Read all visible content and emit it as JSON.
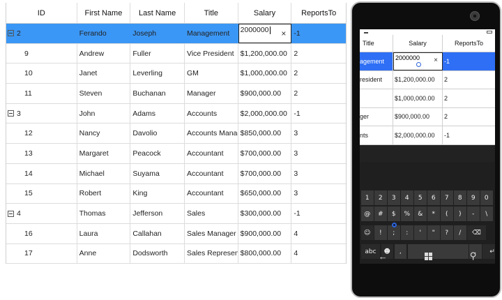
{
  "grid": {
    "columns": [
      "ID",
      "First Name",
      "Last Name",
      "Title",
      "Salary",
      "ReportsTo"
    ],
    "rows": [
      {
        "id": "2",
        "first": "Ferando",
        "last": "Joseph",
        "title": "Management",
        "salary": "2000000",
        "reports": "-1"
      },
      {
        "id": "9",
        "first": "Andrew",
        "last": "Fuller",
        "title": "Vice President",
        "salary": "$1,200,000.00",
        "reports": "2"
      },
      {
        "id": "10",
        "first": "Janet",
        "last": "Leverling",
        "title": "GM",
        "salary": "$1,000,000.00",
        "reports": "2"
      },
      {
        "id": "11",
        "first": "Steven",
        "last": "Buchanan",
        "title": "Manager",
        "salary": "$900,000.00",
        "reports": "2"
      },
      {
        "id": "3",
        "first": "John",
        "last": "Adams",
        "title": "Accounts",
        "salary": "$2,000,000.00",
        "reports": "-1"
      },
      {
        "id": "12",
        "first": "Nancy",
        "last": "Davolio",
        "title": "Accounts Manager",
        "salary": "$850,000.00",
        "reports": "3"
      },
      {
        "id": "13",
        "first": "Margaret",
        "last": "Peacock",
        "title": "Accountant",
        "salary": "$700,000.00",
        "reports": "3"
      },
      {
        "id": "14",
        "first": "Michael",
        "last": "Suyama",
        "title": "Accountant",
        "salary": "$700,000.00",
        "reports": "3"
      },
      {
        "id": "15",
        "first": "Robert",
        "last": "King",
        "title": "Accountant",
        "salary": "$650,000.00",
        "reports": "3"
      },
      {
        "id": "4",
        "first": "Thomas",
        "last": "Jefferson",
        "title": "Sales",
        "salary": "$300,000.00",
        "reports": "-1"
      },
      {
        "id": "16",
        "first": "Laura",
        "last": "Callahan",
        "title": "Sales Manager",
        "salary": "$900,000.00",
        "reports": "4"
      },
      {
        "id": "17",
        "first": "Anne",
        "last": "Dodsworth",
        "title": "Sales Representative",
        "salary": "$800,000.00",
        "reports": "4"
      }
    ],
    "clear_glyph": "×"
  },
  "phone": {
    "columns": [
      "Title",
      "Salary",
      "ReportsTo"
    ],
    "rows": [
      {
        "title": "agement",
        "salary": "2000000",
        "reports": "-1"
      },
      {
        "title": "resident",
        "salary": "$1,200,000.00",
        "reports": "2"
      },
      {
        "title": "",
        "salary": "$1,000,000.00",
        "reports": "2"
      },
      {
        "title": "ger",
        "salary": "$900,000.00",
        "reports": "2"
      },
      {
        "title": "nts",
        "salary": "$2,000,000.00",
        "reports": "-1"
      }
    ],
    "keyboard": {
      "row1": [
        "1",
        "2",
        "3",
        "4",
        "5",
        "6",
        "7",
        "8",
        "9",
        "0"
      ],
      "row2": [
        "@",
        "#",
        "$",
        "%",
        "&",
        "*",
        "(",
        ")",
        "-",
        "\\"
      ],
      "row3": [
        "☺",
        "!",
        ";",
        ":",
        "'",
        "\"",
        "?",
        "/",
        "⌫"
      ],
      "row4": [
        "abc",
        "☻",
        ",",
        "",
        ".",
        "↵"
      ]
    },
    "nav": {
      "back": "←",
      "search": "⚲"
    }
  }
}
